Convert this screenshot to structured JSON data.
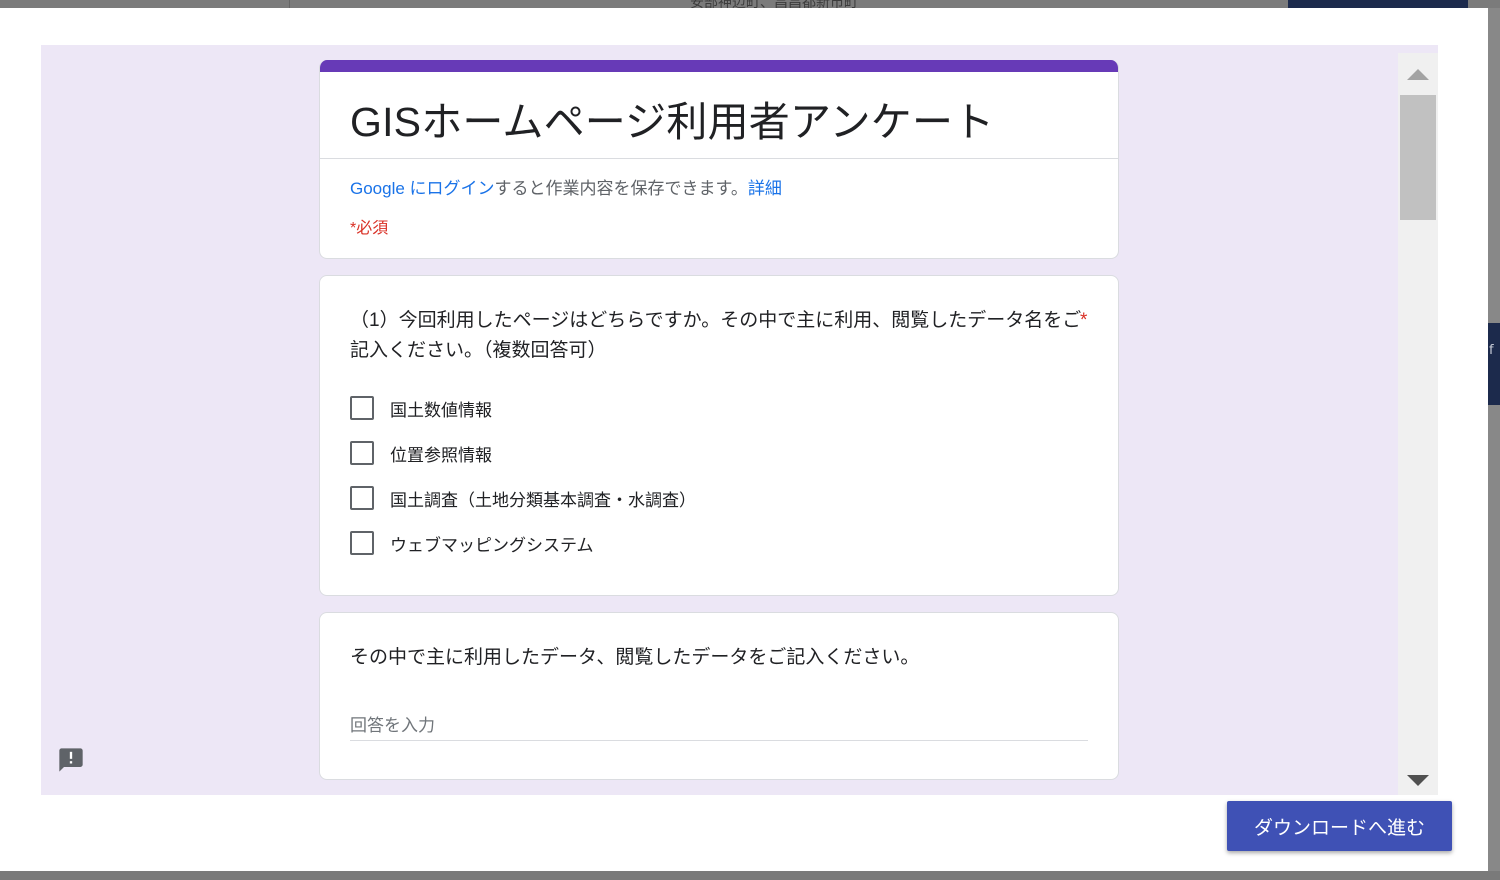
{
  "background": {
    "top_text": "安部神辺町、昌昌都新市町",
    "right_text": "f"
  },
  "form": {
    "title": "GISホームページ利用者アンケート",
    "login": {
      "google_link": "Google にログイン",
      "text": "すると作業内容を保存できます。",
      "details_link": "詳細"
    },
    "required_note": "*必須",
    "question1": {
      "title": "（1）今回利用したページはどちらですか。その中で主に利用、閲覧したデータ名をご記入ください。（複数回答可）",
      "required_mark": "*",
      "options": [
        "国土数値情報",
        "位置参照情報",
        "国土調査（土地分類基本調査・水調査）",
        "ウェブマッピングシステム"
      ]
    },
    "question2": {
      "title": "その中で主に利用したデータ、閲覧したデータをご記入ください。",
      "placeholder": "回答を入力",
      "value": ""
    }
  },
  "icons": {
    "feedback": "report-feedback-icon",
    "scroll_up": "scroll-up-arrow-icon",
    "scroll_down": "scroll-down-arrow-icon"
  },
  "actions": {
    "download_label": "ダウンロードへ進む"
  },
  "colors": {
    "accent": "#673ab7",
    "form_background": "#ede7f6",
    "link": "#1a73e8",
    "required": "#d93025",
    "button": "#3f51b5"
  }
}
